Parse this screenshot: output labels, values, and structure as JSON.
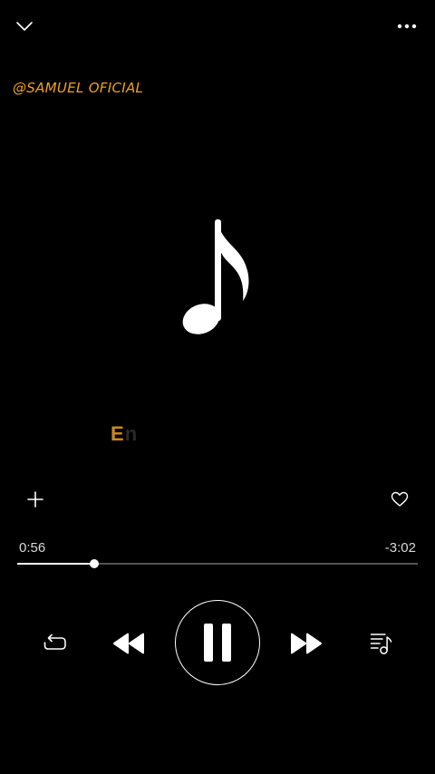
{
  "header": {
    "collapse_icon": "chevron-down-icon",
    "more_icon": "more-horizontal-icon"
  },
  "watermark": {
    "text": "@SAMUEL OFICIAL",
    "color": "#f0a21b"
  },
  "artwork": {
    "icon": "music-note-icon"
  },
  "lyric": {
    "highlighted": "E",
    "rest": "n"
  },
  "actions": {
    "add_icon": "plus-icon",
    "like_icon": "heart-icon"
  },
  "playback": {
    "elapsed": "0:56",
    "remaining": "-3:02",
    "progress": 0.192,
    "state": "playing"
  },
  "controls": {
    "repeat_icon": "repeat-icon",
    "rewind_icon": "rewind-icon",
    "play_pause_icon": "pause-icon",
    "forward_icon": "fast-forward-icon",
    "queue_icon": "queue-list-icon"
  }
}
